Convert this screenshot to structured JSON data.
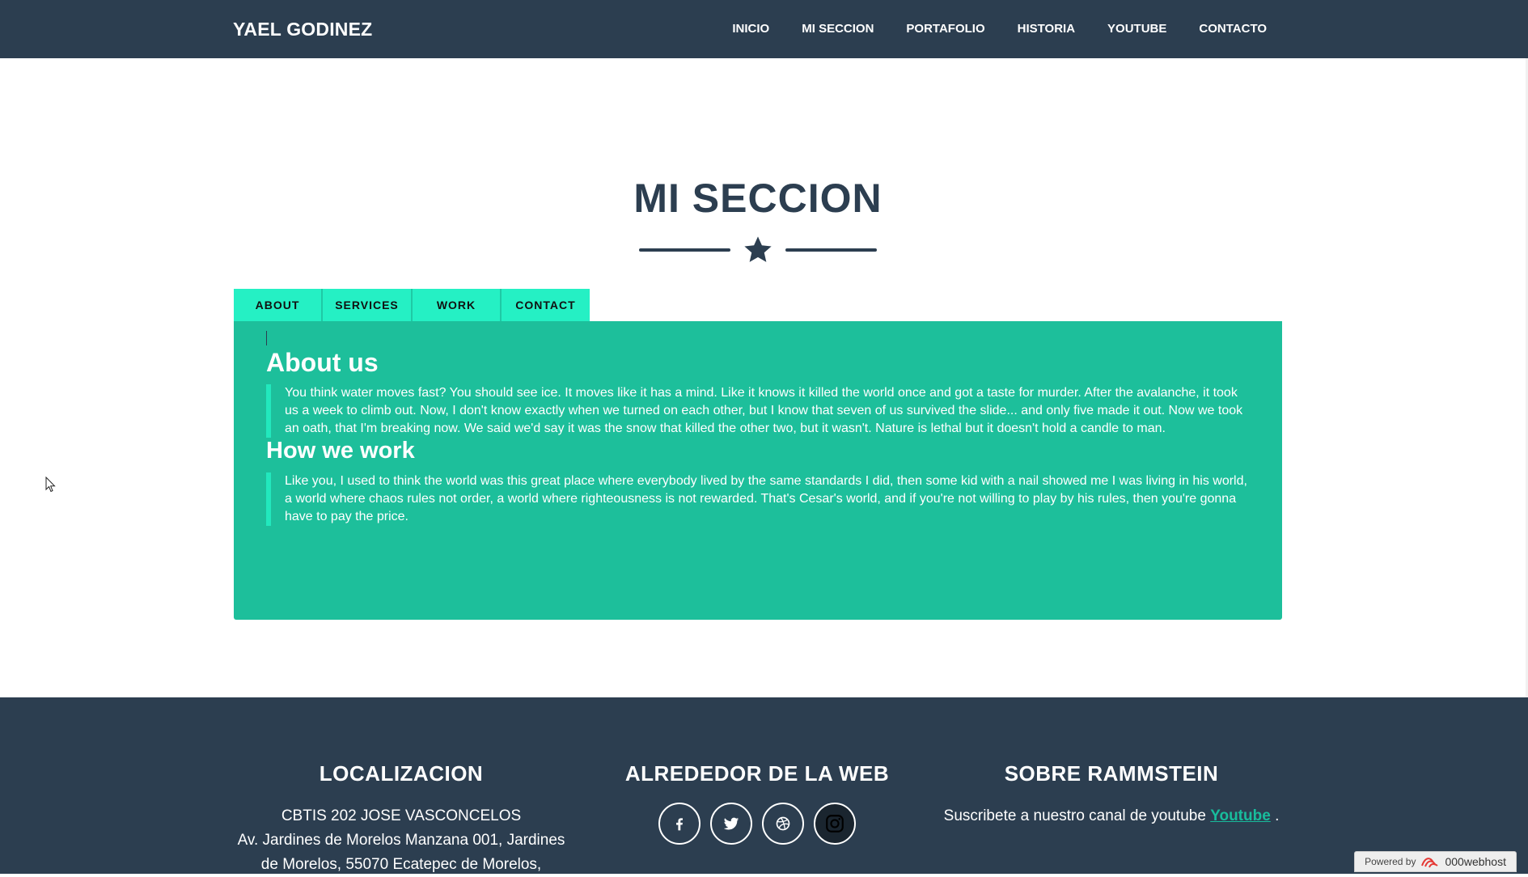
{
  "navbar": {
    "brand": "YAEL GODINEZ",
    "links": [
      "INICIO",
      "MI SECCION",
      "PORTAFOLIO",
      "HISTORIA",
      "YOUTUBE",
      "CONTACTO"
    ]
  },
  "section": {
    "title": "MI SECCION"
  },
  "tabs": {
    "items": [
      "ABOUT",
      "SERVICES",
      "WORK",
      "CONTACT"
    ],
    "active": "ABOUT"
  },
  "panel": {
    "heading1": "About us",
    "text1": "You think water moves fast? You should see ice. It moves like it has a mind. Like it knows it killed the world once and got a taste for murder. After the avalanche, it took us a week to climb out. Now, I don't know exactly when we turned on each other, but I know that seven of us survived the slide... and only five made it out. Now we took an oath, that I'm breaking now. We said we'd say it was the snow that killed the other two, but it wasn't. Nature is lethal but it doesn't hold a candle to man.",
    "heading2": "How we work",
    "text2": "Like you, I used to think the world was this great place where everybody lived by the same standards I did, then some kid with a nail showed me I was living in his world, a world where chaos rules not order, a world where righteousness is not rewarded. That's Cesar's world, and if you're not willing to play by his rules, then you're gonna have to pay the price."
  },
  "footer": {
    "location": {
      "title": "LOCALIZACION",
      "line1": "CBTIS 202 JOSE VASCONCELOS",
      "line2": "Av. Jardines de Morelos Manzana 001, Jardines",
      "line3": "de Morelos, 55070 Ecatepec de Morelos,"
    },
    "web": {
      "title": "ALREDEDOR DE LA WEB",
      "icons": [
        "facebook-icon",
        "twitter-icon",
        "dribbble-icon",
        "instagram-icon"
      ]
    },
    "about": {
      "title": "SOBRE RAMMSTEIN",
      "text": "Suscribete a nuestro canal de youtube",
      "link": "Youtube",
      "period": "."
    }
  },
  "powered": {
    "prefix": "Powered by",
    "brand": "000webhost"
  },
  "colors": {
    "navbar": "#2c3e50",
    "panel": "#1dbf9b",
    "tab": "#25f0c4",
    "active_indicator": "#ff1a00",
    "link": "#18bc9c"
  }
}
